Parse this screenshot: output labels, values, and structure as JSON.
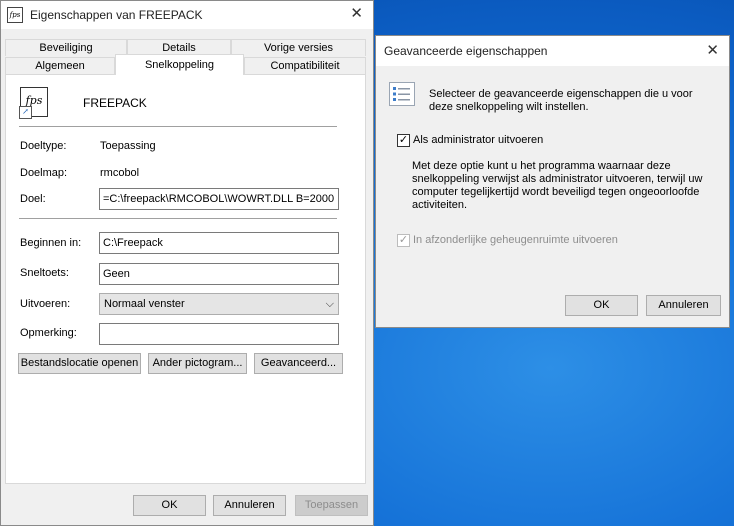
{
  "main_window": {
    "title": "Eigenschappen van FREEPACK",
    "close_glyph": "✕",
    "tabs_row1": [
      "Beveiliging",
      "Details",
      "Vorige versies"
    ],
    "tabs_row2": [
      "Algemeen",
      "Snelkoppeling",
      "Compatibiliteit"
    ],
    "active_tab": "Snelkoppeling",
    "shortcut_name": "FREEPACK",
    "fields": {
      "doeltype_label": "Doeltype:",
      "doeltype_value": "Toepassing",
      "doelmap_label": "Doelmap:",
      "doelmap_value": "rmcobol",
      "doel_label": "Doel:",
      "doel_value": "=C:\\freepack\\RMCOBOL\\WOWRT.DLL B=2000",
      "beginnen_label": "Beginnen in:",
      "beginnen_value": "C:\\Freepack",
      "sneltoets_label": "Sneltoets:",
      "sneltoets_value": "Geen",
      "uitvoeren_label": "Uitvoeren:",
      "uitvoeren_value": "Normaal venster",
      "opmerking_label": "Opmerking:",
      "opmerking_value": ""
    },
    "buttons": {
      "bestandslocatie": "Bestandslocatie openen",
      "ander_pictogram": "Ander pictogram...",
      "geavanceerd": "Geavanceerd...",
      "ok": "OK",
      "annuleren": "Annuleren",
      "toepassen": "Toepassen"
    }
  },
  "advanced_dialog": {
    "title": "Geavanceerde eigenschappen",
    "close_glyph": "✕",
    "intro": "Selecteer de geavanceerde eigenschappen die u voor deze snelkoppeling wilt instellen.",
    "run_as_admin_label": "Als administrator uitvoeren",
    "run_as_admin_checked": true,
    "description": "Met deze optie kunt u het programma waarnaar deze snelkoppeling verwijst als administrator uitvoeren, terwijl uw computer tegelijkertijd wordt beveiligd tegen ongeoorloofde activiteiten.",
    "separate_memory_label": "In afzonderlijke geheugenruimte uitvoeren",
    "separate_memory_checked": true,
    "buttons": {
      "ok": "OK",
      "annuleren": "Annuleren"
    }
  }
}
